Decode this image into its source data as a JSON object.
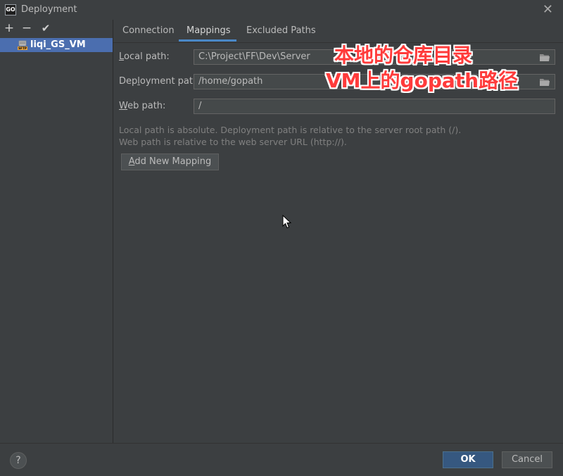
{
  "window": {
    "title": "Deployment",
    "app_icon_text": "GO"
  },
  "toolbar": {
    "add_label": "+",
    "remove_label": "−",
    "apply_label": "✔"
  },
  "servers": [
    {
      "name": "liqi_GS_VM",
      "icon": "sftp-server-icon",
      "selected": true
    }
  ],
  "tabs": [
    {
      "label": "Connection",
      "active": false
    },
    {
      "label": "Mappings",
      "active": true
    },
    {
      "label": "Excluded Paths",
      "active": false
    }
  ],
  "mappings": {
    "local_path": {
      "mnemonic": "L",
      "rest": "ocal path:",
      "value": "C:\\Project\\FF\\Dev\\Server"
    },
    "deployment_path": {
      "pre": "Dep",
      "mnemonic": "l",
      "rest": "oyment path:",
      "value": "/home/gopath"
    },
    "web_path": {
      "mnemonic": "W",
      "rest": "eb path:",
      "value": "/"
    },
    "hint_line1": "Local path is absolute. Deployment path is relative to the server root path (/).",
    "hint_line2": "Web path is relative to the web server URL (http://).",
    "add_button": {
      "mnemonic": "A",
      "rest": "dd New Mapping"
    }
  },
  "annotations": {
    "line1": "本地的仓库目录",
    "line2": "VM上的gopath路径"
  },
  "footer": {
    "help_label": "?",
    "ok_label": "OK",
    "cancel_label": "Cancel"
  },
  "colors": {
    "background": "#3c3f41",
    "selection": "#4b6eaf",
    "tab_underline": "#4a88c7",
    "ok_button": "#365880",
    "annotation": "#ff3b3b"
  }
}
